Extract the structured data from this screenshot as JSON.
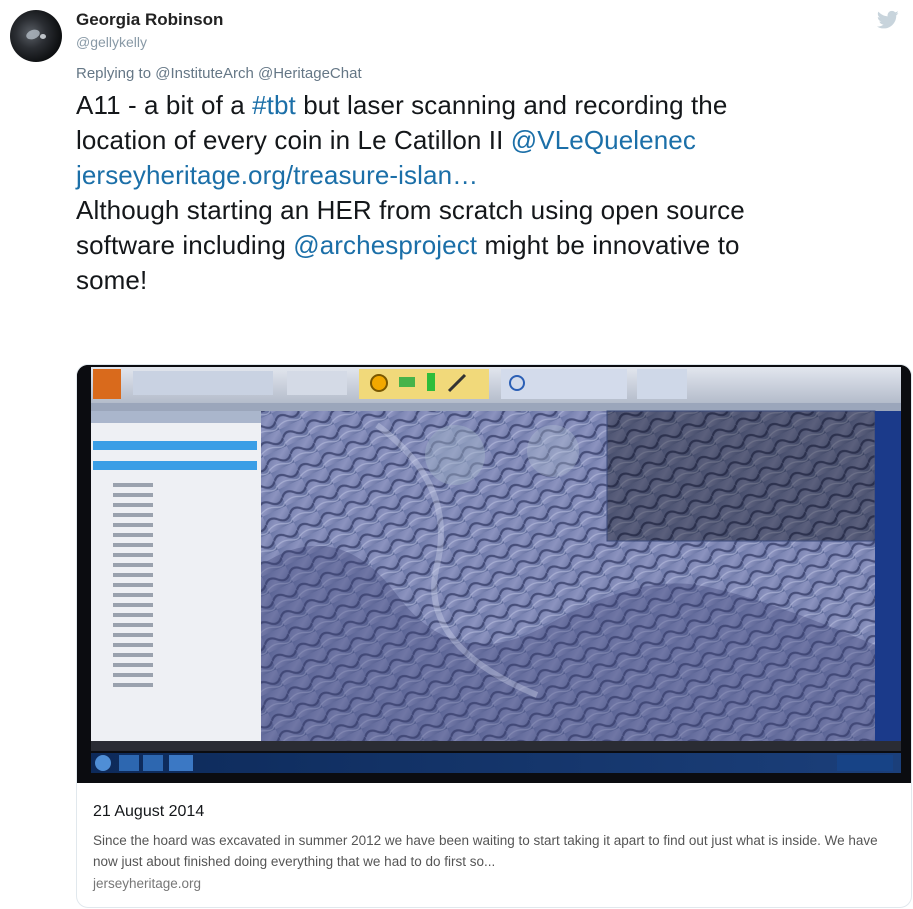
{
  "tweet": {
    "display_name": "Georgia Robinson",
    "handle": "@gellykelly",
    "replying_prefix": "Replying to",
    "replying_to": [
      "@InstituteArch",
      "@HeritageChat"
    ],
    "text": {
      "line1_a": "A11 - a bit of a ",
      "line1_hashtag": "#tbt",
      "line1_b": " but laser scanning and recording the",
      "line2_a": "location of every coin in Le Catillon II ",
      "line2_mention": "@VLeQuelenec",
      "line3_link": "jerseyheritage.org/treasure-islan…",
      "line4": "Although starting an HER from scratch using open source",
      "line5_a": "software including ",
      "line5_mention": "@archesproject",
      "line5_b": " might be innovative to",
      "line6": "some!"
    }
  },
  "card": {
    "date": "21 August 2014",
    "description": "Since the hoard was excavated in summer 2012 we have been waiting to start taking it apart to find out just what is inside. We have now just about finished doing everything that we had to do first so...",
    "domain": "jerseyheritage.org"
  },
  "icons": {
    "bird": "twitter-bird-icon"
  },
  "colors": {
    "link": "#1b6fa8",
    "text": "#14171a",
    "secondary": "#657786",
    "bird": "#c8d4dc"
  }
}
